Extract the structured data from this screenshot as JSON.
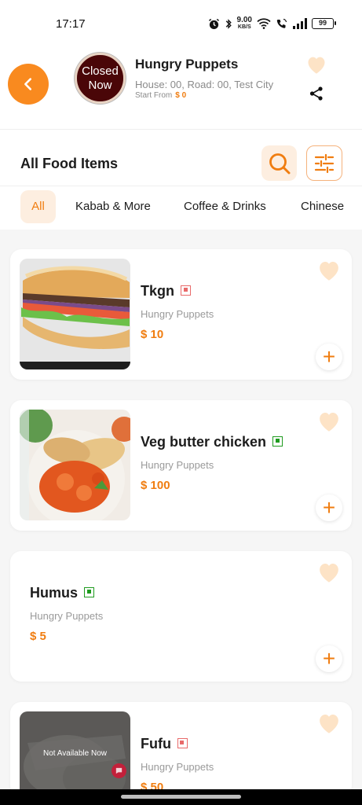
{
  "status_bar": {
    "time": "17:17",
    "speed_value": "9.00",
    "speed_unit": "KB/S",
    "battery": "99",
    "icons": [
      "alarm-icon",
      "bluetooth-icon",
      "wifi-icon",
      "volte-call-icon",
      "signal-icon",
      "battery-icon"
    ]
  },
  "restaurant": {
    "logo_overlay": "Closed Now",
    "name": "Hungry Puppets",
    "address": "House: 00, Road: 00, Test City",
    "start_from_label": "Start From",
    "start_from_value": "$ 0"
  },
  "section": {
    "title": "All Food Items"
  },
  "categories": [
    "All",
    "Kabab & More",
    "Coffee & Drinks",
    "Chinese"
  ],
  "active_category": "All",
  "items": [
    {
      "name": "Tkgn",
      "diet": "non-veg",
      "restaurant": "Hungry Puppets",
      "price": "$ 10",
      "image": "sandwich"
    },
    {
      "name": "Veg butter chicken",
      "diet": "veg",
      "restaurant": "Hungry Puppets",
      "price": "$ 100",
      "image": "butter-chicken"
    },
    {
      "name": "Humus",
      "diet": "veg",
      "restaurant": "Hungry Puppets",
      "price": "$ 5",
      "image": "none"
    },
    {
      "name": "Fufu",
      "diet": "non-veg",
      "restaurant": "Hungry Puppets",
      "price": "$ 50",
      "image": "fufu",
      "availability": "Not Available Now"
    }
  ],
  "colors": {
    "accent": "#f98a1f",
    "accent_text": "#f07d10",
    "accent_light": "#fdeee0",
    "heart": "#fde3c6",
    "veg": "#1e9b1e",
    "non_veg": "#e86a6a"
  }
}
